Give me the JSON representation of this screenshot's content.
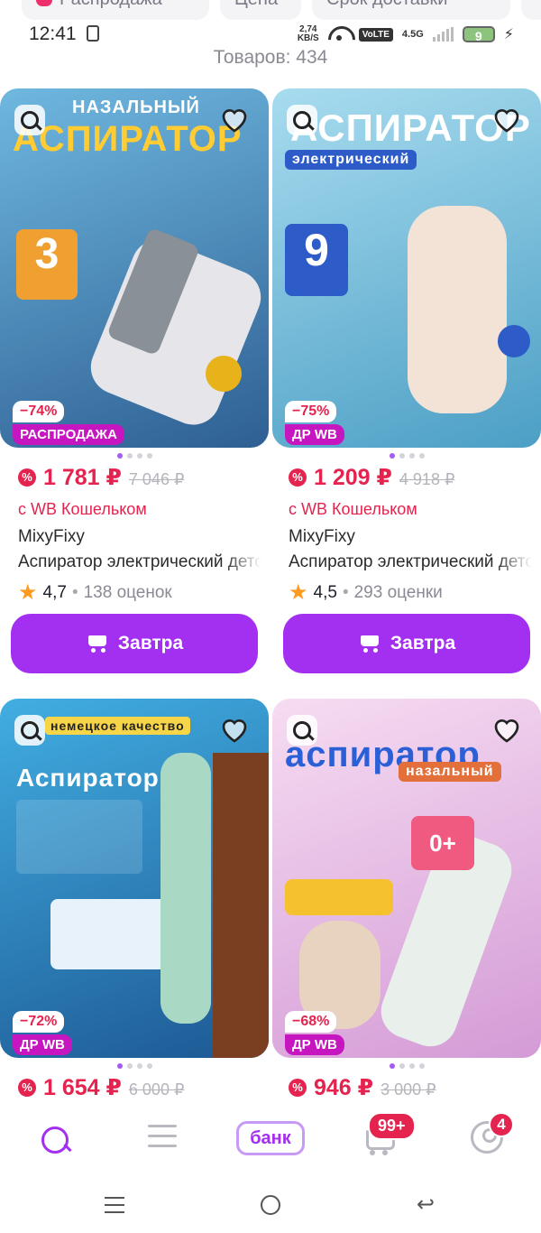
{
  "filters": [
    "Распродажа",
    "Цена",
    "Срок доставки"
  ],
  "status": {
    "time": "12:41",
    "net_speed_top": "2,74",
    "net_speed_unit": "KB/S",
    "volte": "VoLTE",
    "net": "4.5G",
    "battery": "9"
  },
  "product_count": "Товаров: 434",
  "products": [
    {
      "image_headline": "АСПИРАТОР",
      "image_top_text": "НАЗАЛЬНЫЙ",
      "discount": "−74%",
      "tag": "РАСПРОДАЖА",
      "price": "1 781 ₽",
      "old_price": "7 046 ₽",
      "wallet": "с WB Кошельком",
      "brand": "MixyFixy",
      "name": "Аспиратор электрический детский",
      "rating": "4,7",
      "reviews": "138 оценок",
      "delivery": "Завтра",
      "colors": {
        "bg1": "#5aa7d4",
        "bg2": "#2f6aa0"
      }
    },
    {
      "image_headline": "АСПИРАТОР",
      "image_top_text": "электрический",
      "discount": "−75%",
      "tag": "ДР WB",
      "price": "1 209 ₽",
      "old_price": "4 918 ₽",
      "wallet": "с WB Кошельком",
      "brand": "MixyFixy",
      "name": "Аспиратор электрический детский",
      "rating": "4,5",
      "reviews": "293 оценки",
      "delivery": "Завтра",
      "colors": {
        "bg1": "#8fd0e8",
        "bg2": "#4aa0c8"
      }
    },
    {
      "image_headline": "Аспиратор",
      "image_top_text": "немецкое качество",
      "discount": "−72%",
      "tag": "ДР WB",
      "price": "1 654 ₽",
      "old_price": "6 000 ₽",
      "colors": {
        "bg1": "#3aa6dc",
        "bg2": "#1d5e9a"
      }
    },
    {
      "image_headline": "аспиратор",
      "image_top_text": "назальный",
      "discount": "−68%",
      "tag": "ДР WB",
      "price": "946 ₽",
      "old_price": "3 000 ₽",
      "colors": {
        "bg1": "#f4d6f0",
        "bg2": "#d79ad8"
      }
    }
  ],
  "nav": {
    "bank": "банк",
    "cart_badge": "99+",
    "profile_badge": "4"
  },
  "accent": "#a32ff0",
  "sale_color": "#e4244f"
}
